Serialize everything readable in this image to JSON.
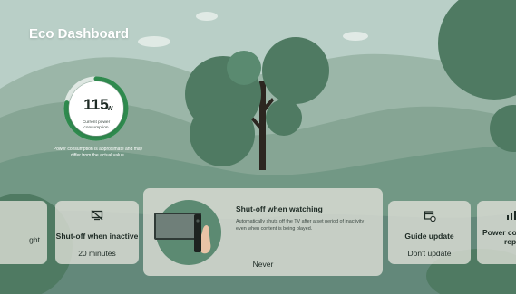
{
  "header": {
    "title": "Eco Dashboard"
  },
  "power": {
    "value": "115",
    "unit": "W",
    "label": "Current power consumption",
    "note": "Power consumption is approximate and may differ from the actual value.",
    "gauge_fraction": 0.78
  },
  "cards": {
    "left_partial": {
      "value": "ght"
    },
    "inactive": {
      "title": "Shut-off when inactive",
      "value": "20 minutes"
    },
    "watching": {
      "title": "Shut-off when watching",
      "description": "Automatically shuts off the TV after a set period of inactivity even when content is being played.",
      "value": "Never"
    },
    "guide": {
      "title": "Guide update",
      "value": "Don't update"
    },
    "report": {
      "title": "Power cons",
      "title_line2": "rep"
    }
  },
  "colors": {
    "sky": "#b9cfc7",
    "hill_far": "#9bb6a8",
    "hill_mid": "#7fa08f",
    "hill_near": "#6b8e7b",
    "tree": "#4f7a62",
    "gauge_accent": "#2f8a4e",
    "card_bg": "#e1e1da"
  },
  "icons": {
    "inactive": "monitor-off-icon",
    "guide": "calendar-sync-icon",
    "report": "bar-chart-icon"
  }
}
